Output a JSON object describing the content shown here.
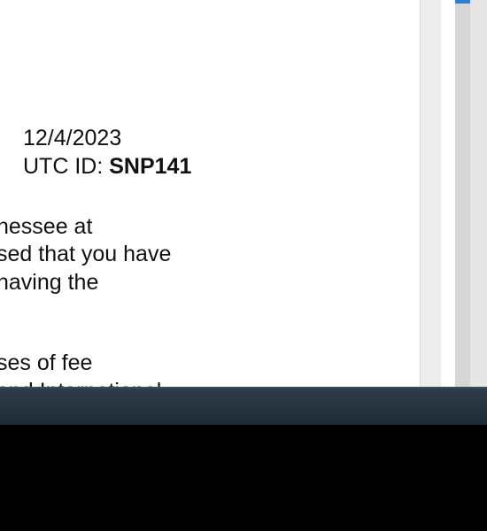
{
  "document": {
    "date": "12/4/2023",
    "id_label": "UTC ID:",
    "id_value": "SNP141",
    "lines": [
      "nessee at",
      "sed that you have",
      " having the",
      "ses of fee",
      "and International"
    ]
  },
  "scrollbars": {
    "inner_arrow_icon": "chevron-down-icon"
  },
  "taskbar": {
    "color": "#263440"
  }
}
